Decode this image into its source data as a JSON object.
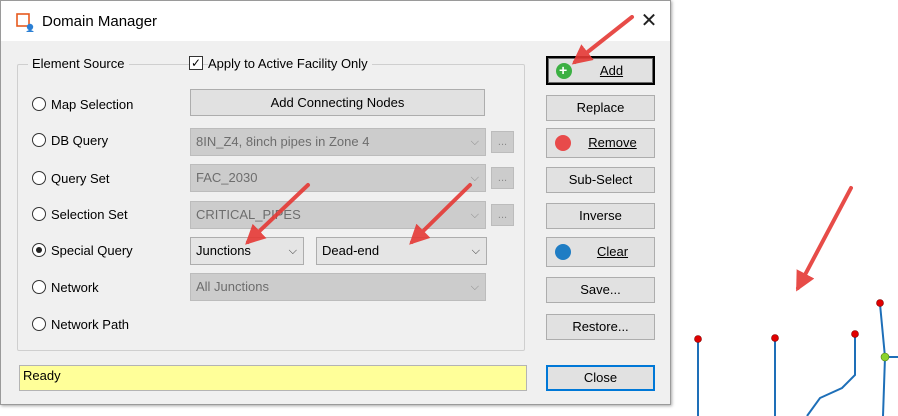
{
  "window": {
    "title": "Domain Manager",
    "close_glyph": "✕"
  },
  "element_source": {
    "group_label": "Element Source",
    "apply_active_facility": {
      "label": "Apply to Active Facility Only",
      "checked": true
    },
    "radios": [
      {
        "label": "Map Selection",
        "selected": false
      },
      {
        "label": "DB Query",
        "selected": false
      },
      {
        "label": "Query Set",
        "selected": false
      },
      {
        "label": "Selection Set",
        "selected": false
      },
      {
        "label": "Special Query",
        "selected": true
      },
      {
        "label": "Network",
        "selected": false
      },
      {
        "label": "Network Path",
        "selected": false
      }
    ],
    "add_connecting_nodes": "Add Connecting Nodes",
    "db_query_value": "8IN_Z4, 8inch pipes in Zone 4",
    "query_set_value": "FAC_2030",
    "selection_set_value": "CRITICAL_PIPES",
    "special_query_type": "Junctions",
    "special_query_filter": "Dead-end",
    "network_value": "All Junctions",
    "ellipsis": "..."
  },
  "actions": {
    "add": "Add",
    "replace": "Replace",
    "remove": "Remove",
    "sub_select": "Sub-Select",
    "inverse": "Inverse",
    "clear": "Clear",
    "save": "Save...",
    "restore": "Restore...",
    "close": "Close"
  },
  "status": "Ready",
  "colors": {
    "annotation_arrow": "#e53935",
    "status_bg": "#ffff99",
    "pipe": "#1e6fb8",
    "dead_end_node": "#e00000",
    "junction_node": "#8bd32c"
  }
}
